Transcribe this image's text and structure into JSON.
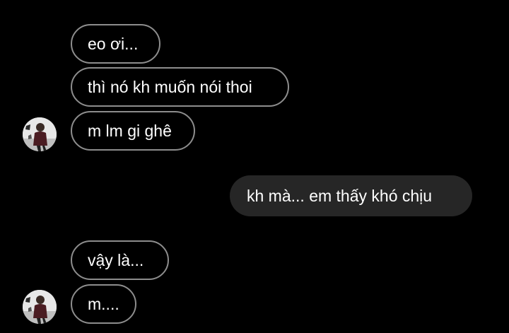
{
  "conversation": {
    "messages": [
      {
        "sender": "other",
        "text": "eo ơi..."
      },
      {
        "sender": "other",
        "text": "thì nó kh muốn nói thoi"
      },
      {
        "sender": "other",
        "text": "m lm gi ghê"
      },
      {
        "sender": "me",
        "text": "kh mà... em thấy khó chịu"
      },
      {
        "sender": "other",
        "text": "vậy là..."
      },
      {
        "sender": "other",
        "text": "m...."
      }
    ]
  },
  "colors": {
    "background": "#000000",
    "incoming_border": "#8d8d8d",
    "outgoing_fill": "#262626",
    "text": "#ffffff"
  },
  "icons": {
    "avatar": "profile-photo-avatar"
  }
}
